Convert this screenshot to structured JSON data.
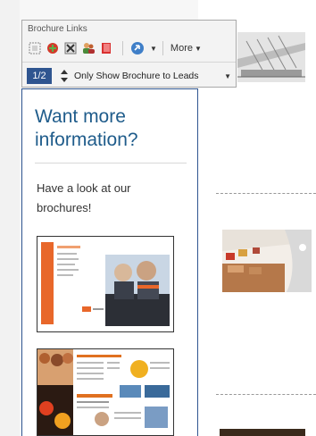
{
  "toolbar": {
    "title": "Brochure Links",
    "more_label": "More",
    "page_indicator": "1/2",
    "filter_label": "Only Show Brochure to Leads",
    "icons": [
      "select-icon",
      "add-icon",
      "delete-icon",
      "users-icon",
      "book-icon",
      "navigate-icon"
    ]
  },
  "panel": {
    "title": "Want more information?",
    "body": "Have a look at our brochures!"
  },
  "colors": {
    "accent": "#2f5590",
    "title": "#1f5c8b"
  }
}
